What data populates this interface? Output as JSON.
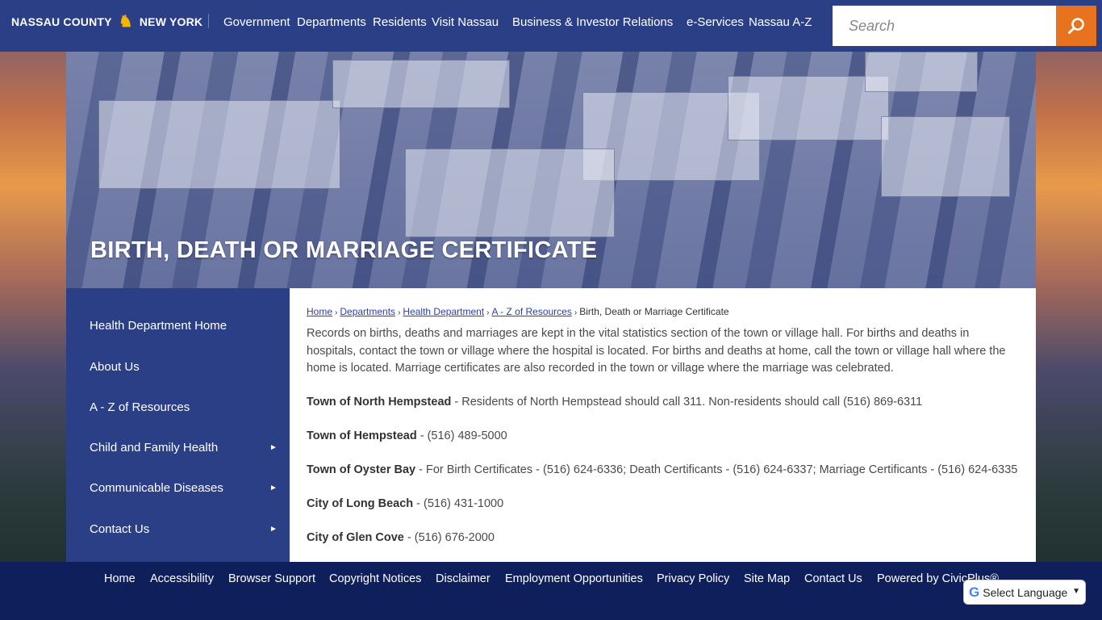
{
  "header": {
    "logo_left": "NASSAU COUNTY",
    "logo_right": "NEW YORK",
    "nav": [
      "Government",
      "Departments",
      "Residents",
      "Visit Nassau",
      "Business & Investor Relations",
      "e-Services",
      "Nassau A-Z"
    ],
    "search_placeholder": "Search"
  },
  "hero": {
    "title": "BIRTH, DEATH OR MARRIAGE CERTIFICATE"
  },
  "sidebar": {
    "items": [
      {
        "label": "Health Department Home",
        "has_submenu": false
      },
      {
        "label": "About Us",
        "has_submenu": false
      },
      {
        "label": "A - Z of Resources",
        "has_submenu": false
      },
      {
        "label": "Child and Family Health",
        "has_submenu": true
      },
      {
        "label": "Communicable Diseases",
        "has_submenu": true
      },
      {
        "label": "Contact Us",
        "has_submenu": true
      }
    ],
    "arrow": "►"
  },
  "breadcrumb": {
    "links": [
      "Home",
      "Departments",
      "Health Department",
      "A - Z of Resources"
    ],
    "current": "Birth, Death or Marriage Certificate",
    "separator": "›"
  },
  "content": {
    "intro": "Records on births, deaths and marriages are kept in the vital statistics section of the town or village hall. For births and deaths in hospitals, contact the town or village where the hospital is located. For births and deaths at home, call the town or village hall where the home is located. Marriage certificates are also recorded in the town or village where the marriage was celebrated.",
    "entries": [
      {
        "name": "Town of North Hempstead",
        "detail": " - Residents of North Hempstead should call 311. Non-residents should call (516) 869-6311"
      },
      {
        "name": "Town of Hempstead",
        "detail": " - (516) 489-5000"
      },
      {
        "name": "Town of Oyster Bay",
        "detail": " - For Birth Certificates - (516) 624-6336; Death Certificants - (516) 624-6337; Marriage Certificants - (516) 624-6335"
      },
      {
        "name": "City of Long Beach",
        "detail": " - (516) 431-1000"
      },
      {
        "name": "City of Glen Cove",
        "detail": " - (516) 676-2000"
      }
    ]
  },
  "footer": {
    "links": [
      "Home",
      "Accessibility",
      "Browser Support",
      "Copyright Notices",
      "Disclaimer",
      "Employment Opportunities",
      "Privacy Policy",
      "Site Map",
      "Contact Us",
      "Powered by CivicPlus®"
    ]
  },
  "language": {
    "label": "Select Language"
  },
  "colors": {
    "header_bg": "#2b3f86",
    "search_button": "#e8731f",
    "footer_bg": "#0f1f5c",
    "link": "#2b3fa6"
  }
}
